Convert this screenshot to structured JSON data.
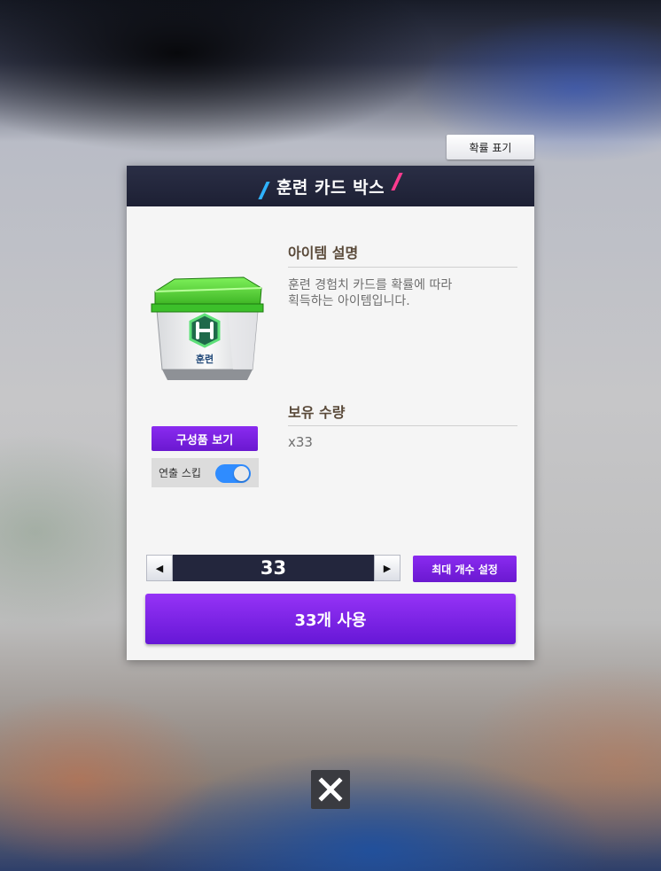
{
  "popup": {
    "probability_button": "확률 표기",
    "title": "훈련 카드 박스",
    "item_image_label": "훈련",
    "description_title": "아이템 설명",
    "description_line1": "훈련 경험치 카드를 확률에 따라",
    "description_line2": "획득하는 아이템입니다.",
    "quantity_title": "보유 수량",
    "quantity_value": "x33",
    "components_button": "구성품 보기",
    "skip_animation_label": "연출 스킵",
    "skip_animation_on": true,
    "stepper_value": "33",
    "max_count_button": "최대 개수 설정",
    "use_button": "33개 사용"
  },
  "icons": {
    "close": "close-icon",
    "left_arrow": "arrow-left-icon",
    "right_arrow": "arrow-right-icon"
  },
  "colors": {
    "accent_purple": "#7a22e6",
    "header_navy": "#23263d",
    "toggle_blue": "#2f8cff",
    "box_green": "#3fcf2a"
  }
}
